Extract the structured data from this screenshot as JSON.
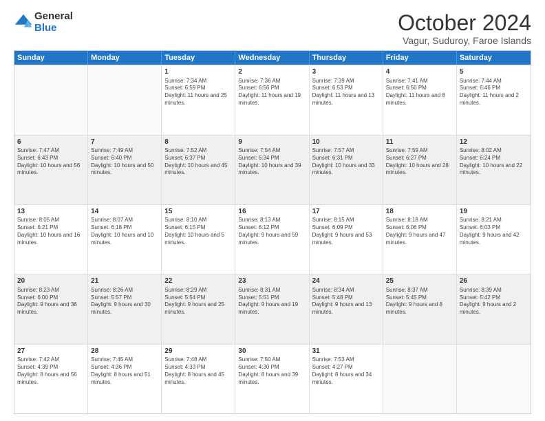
{
  "logo": {
    "general": "General",
    "blue": "Blue"
  },
  "header": {
    "title": "October 2024",
    "subtitle": "Vagur, Suduroy, Faroe Islands"
  },
  "days": [
    "Sunday",
    "Monday",
    "Tuesday",
    "Wednesday",
    "Thursday",
    "Friday",
    "Saturday"
  ],
  "weeks": [
    [
      {
        "day": "",
        "text": "",
        "empty": true
      },
      {
        "day": "",
        "text": "",
        "empty": true
      },
      {
        "day": "1",
        "text": "Sunrise: 7:34 AM\nSunset: 6:59 PM\nDaylight: 11 hours and 25 minutes."
      },
      {
        "day": "2",
        "text": "Sunrise: 7:36 AM\nSunset: 6:56 PM\nDaylight: 11 hours and 19 minutes."
      },
      {
        "day": "3",
        "text": "Sunrise: 7:39 AM\nSunset: 6:53 PM\nDaylight: 11 hours and 13 minutes."
      },
      {
        "day": "4",
        "text": "Sunrise: 7:41 AM\nSunset: 6:50 PM\nDaylight: 11 hours and 8 minutes."
      },
      {
        "day": "5",
        "text": "Sunrise: 7:44 AM\nSunset: 6:46 PM\nDaylight: 11 hours and 2 minutes."
      }
    ],
    [
      {
        "day": "6",
        "text": "Sunrise: 7:47 AM\nSunset: 6:43 PM\nDaylight: 10 hours and 56 minutes.",
        "shaded": true
      },
      {
        "day": "7",
        "text": "Sunrise: 7:49 AM\nSunset: 6:40 PM\nDaylight: 10 hours and 50 minutes.",
        "shaded": true
      },
      {
        "day": "8",
        "text": "Sunrise: 7:52 AM\nSunset: 6:37 PM\nDaylight: 10 hours and 45 minutes.",
        "shaded": true
      },
      {
        "day": "9",
        "text": "Sunrise: 7:54 AM\nSunset: 6:34 PM\nDaylight: 10 hours and 39 minutes.",
        "shaded": true
      },
      {
        "day": "10",
        "text": "Sunrise: 7:57 AM\nSunset: 6:31 PM\nDaylight: 10 hours and 33 minutes.",
        "shaded": true
      },
      {
        "day": "11",
        "text": "Sunrise: 7:59 AM\nSunset: 6:27 PM\nDaylight: 10 hours and 28 minutes.",
        "shaded": true
      },
      {
        "day": "12",
        "text": "Sunrise: 8:02 AM\nSunset: 6:24 PM\nDaylight: 10 hours and 22 minutes.",
        "shaded": true
      }
    ],
    [
      {
        "day": "13",
        "text": "Sunrise: 8:05 AM\nSunset: 6:21 PM\nDaylight: 10 hours and 16 minutes."
      },
      {
        "day": "14",
        "text": "Sunrise: 8:07 AM\nSunset: 6:18 PM\nDaylight: 10 hours and 10 minutes."
      },
      {
        "day": "15",
        "text": "Sunrise: 8:10 AM\nSunset: 6:15 PM\nDaylight: 10 hours and 5 minutes."
      },
      {
        "day": "16",
        "text": "Sunrise: 8:13 AM\nSunset: 6:12 PM\nDaylight: 9 hours and 59 minutes."
      },
      {
        "day": "17",
        "text": "Sunrise: 8:15 AM\nSunset: 6:09 PM\nDaylight: 9 hours and 53 minutes."
      },
      {
        "day": "18",
        "text": "Sunrise: 8:18 AM\nSunset: 6:06 PM\nDaylight: 9 hours and 47 minutes."
      },
      {
        "day": "19",
        "text": "Sunrise: 8:21 AM\nSunset: 6:03 PM\nDaylight: 9 hours and 42 minutes."
      }
    ],
    [
      {
        "day": "20",
        "text": "Sunrise: 8:23 AM\nSunset: 6:00 PM\nDaylight: 9 hours and 36 minutes.",
        "shaded": true
      },
      {
        "day": "21",
        "text": "Sunrise: 8:26 AM\nSunset: 5:57 PM\nDaylight: 9 hours and 30 minutes.",
        "shaded": true
      },
      {
        "day": "22",
        "text": "Sunrise: 8:29 AM\nSunset: 5:54 PM\nDaylight: 9 hours and 25 minutes.",
        "shaded": true
      },
      {
        "day": "23",
        "text": "Sunrise: 8:31 AM\nSunset: 5:51 PM\nDaylight: 9 hours and 19 minutes.",
        "shaded": true
      },
      {
        "day": "24",
        "text": "Sunrise: 8:34 AM\nSunset: 5:48 PM\nDaylight: 9 hours and 13 minutes.",
        "shaded": true
      },
      {
        "day": "25",
        "text": "Sunrise: 8:37 AM\nSunset: 5:45 PM\nDaylight: 9 hours and 8 minutes.",
        "shaded": true
      },
      {
        "day": "26",
        "text": "Sunrise: 8:39 AM\nSunset: 5:42 PM\nDaylight: 9 hours and 2 minutes.",
        "shaded": true
      }
    ],
    [
      {
        "day": "27",
        "text": "Sunrise: 7:42 AM\nSunset: 4:39 PM\nDaylight: 8 hours and 56 minutes."
      },
      {
        "day": "28",
        "text": "Sunrise: 7:45 AM\nSunset: 4:36 PM\nDaylight: 8 hours and 51 minutes."
      },
      {
        "day": "29",
        "text": "Sunrise: 7:48 AM\nSunset: 4:33 PM\nDaylight: 8 hours and 45 minutes."
      },
      {
        "day": "30",
        "text": "Sunrise: 7:50 AM\nSunset: 4:30 PM\nDaylight: 8 hours and 39 minutes."
      },
      {
        "day": "31",
        "text": "Sunrise: 7:53 AM\nSunset: 4:27 PM\nDaylight: 8 hours and 34 minutes."
      },
      {
        "day": "",
        "text": "",
        "empty": true
      },
      {
        "day": "",
        "text": "",
        "empty": true
      }
    ]
  ]
}
